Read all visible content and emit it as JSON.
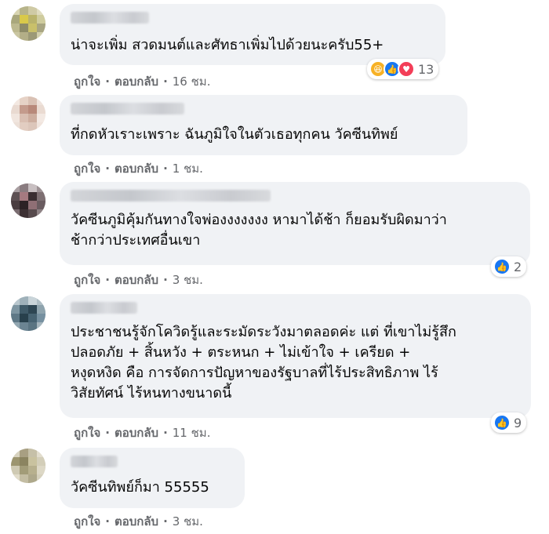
{
  "comments": [
    {
      "text": "น่าจะเพิ่ม สวดมนต์และศัทธาเพิ่มไปด้วยนะครับ55+",
      "like_label": "ถูกใจ",
      "reply_label": "ตอบกลับ",
      "time": "16 ชม.",
      "reactions": [
        "haha-icon",
        "like-icon",
        "love-icon"
      ],
      "reaction_count": "13"
    },
    {
      "text": "ที่กดหัวเราะเพราะ ฉันภูมิใจในตัวเธอทุกคน วัคซีนทิพย์",
      "like_label": "ถูกใจ",
      "reply_label": "ตอบกลับ",
      "time": "1 ชม."
    },
    {
      "text": "วัคซีนภูมิคุ้มกันทางใจพ่องงงงงงง หามาได้ช้า ก็ยอมรับผิดมาว่า\nช้ากว่าประเทศอื่นเขา",
      "like_label": "ถูกใจ",
      "reply_label": "ตอบกลับ",
      "time": "3 ชม.",
      "reactions": [
        "like-icon"
      ],
      "reaction_count": "2"
    },
    {
      "text": "ประชาชนรู้จักโควิดรู้และระมัดระวังมาตลอดค่ะ แต่ ที่เขาไม่รู้สึก\nปลอดภัย + สิ้นหวัง + ตระหนก + ไม่เข้าใจ + เครียด +\nหงุดหงิด คือ การจัดการปัญหาของรัฐบาลที่ไร้ประสิทธิภาพ ไร้\nวิสัยทัศน์ ไร้หนทางขนาดนี้",
      "like_label": "ถูกใจ",
      "reply_label": "ตอบกลับ",
      "time": "11 ชม.",
      "reactions": [
        "like-icon"
      ],
      "reaction_count": "9"
    },
    {
      "text": "วัคซีนทิพย์ก็มา 55555",
      "like_label": "ถูกใจ",
      "reply_label": "ตอบกลับ",
      "time": "3 ชม."
    }
  ],
  "colors": {
    "bubble": "#f0f2f5",
    "meta": "#65676b",
    "like": "#1877f2",
    "love": "#f33e58",
    "haha": "#f7b125"
  }
}
